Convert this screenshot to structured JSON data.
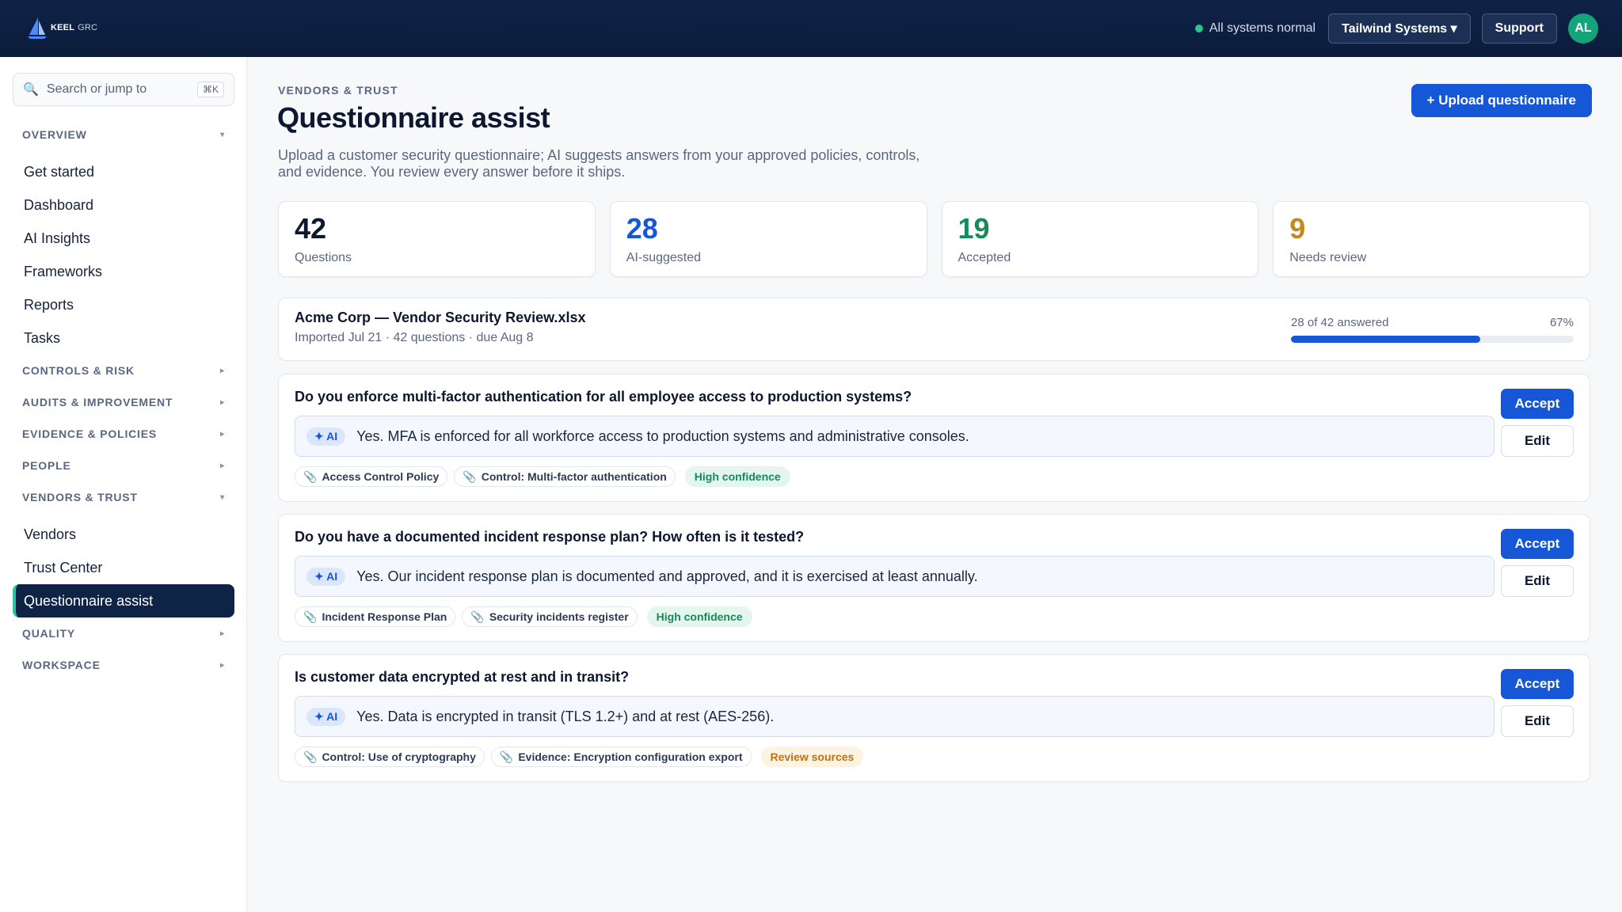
{
  "app": {
    "logo_bold": "KEEL",
    "logo_light": "GRC",
    "status_text": "All systems normal",
    "org_switcher": "Tailwind Systems ▾",
    "support_label": "Support",
    "avatar_initials": "AL"
  },
  "sidebar": {
    "search_placeholder": "Search or jump to",
    "search_shortcut": "⌘K",
    "sections": {
      "overview": "OVERVIEW",
      "controls": "CONTROLS & RISK",
      "audits": "AUDITS & IMPROVEMENT",
      "evidence": "EVIDENCE & POLICIES",
      "people": "PEOPLE",
      "vendors": "VENDORS & TRUST",
      "quality": "QUALITY",
      "workspace": "WORKSPACE"
    },
    "overview_items": [
      "Get started",
      "Dashboard",
      "AI Insights",
      "Frameworks",
      "Reports",
      "Tasks"
    ],
    "vendors_items": [
      "Vendors",
      "Trust Center",
      "Questionnaire assist"
    ]
  },
  "page": {
    "eyebrow": "VENDORS & TRUST",
    "title": "Questionnaire assist",
    "subtitle": "Upload a customer security questionnaire; AI suggests answers from your approved policies, controls, and evidence. You review every answer before it ships.",
    "upload_label": "+ Upload questionnaire"
  },
  "stats": [
    {
      "value": "42",
      "label": "Questions",
      "color": "#0c1730"
    },
    {
      "value": "28",
      "label": "AI-suggested",
      "color": "#1557d6"
    },
    {
      "value": "19",
      "label": "Accepted",
      "color": "#16895d"
    },
    {
      "value": "9",
      "label": "Needs review",
      "color": "#c28a1e"
    }
  ],
  "file": {
    "name": "Acme Corp — Vendor Security Review.xlsx",
    "meta": "Imported Jul 21 · 42 questions · due Aug 8",
    "progress_text": "28 of 42 answered",
    "progress_pct": "67%",
    "progress_fraction": 0.67
  },
  "questions": [
    {
      "question": "Do you enforce multi-factor authentication for all employee access to production systems?",
      "ai_label": "✦ AI",
      "answer": "Yes. MFA is enforced for all workforce access to production systems and administrative consoles.",
      "sources": [
        "Access Control Policy",
        "Control: Multi-factor authentication"
      ],
      "confidence": "High confidence",
      "accept_label": "Accept",
      "edit_label": "Edit"
    },
    {
      "question": "Do you have a documented incident response plan? How often is it tested?",
      "ai_label": "✦ AI",
      "answer": "Yes. Our incident response plan is documented and approved, and it is exercised at least annually.",
      "sources": [
        "Incident Response Plan",
        "Security incidents register"
      ],
      "confidence": "High confidence",
      "accept_label": "Accept",
      "edit_label": "Edit"
    },
    {
      "question": "Is customer data encrypted at rest and in transit?",
      "ai_label": "✦ AI",
      "answer": "Yes. Data is encrypted in transit (TLS 1.2+) and at rest (AES-256).",
      "sources": [
        "Control: Use of cryptography",
        "Evidence: Encryption configuration export"
      ],
      "confidence": "Review sources",
      "accept_label": "Accept",
      "edit_label": "Edit"
    }
  ]
}
